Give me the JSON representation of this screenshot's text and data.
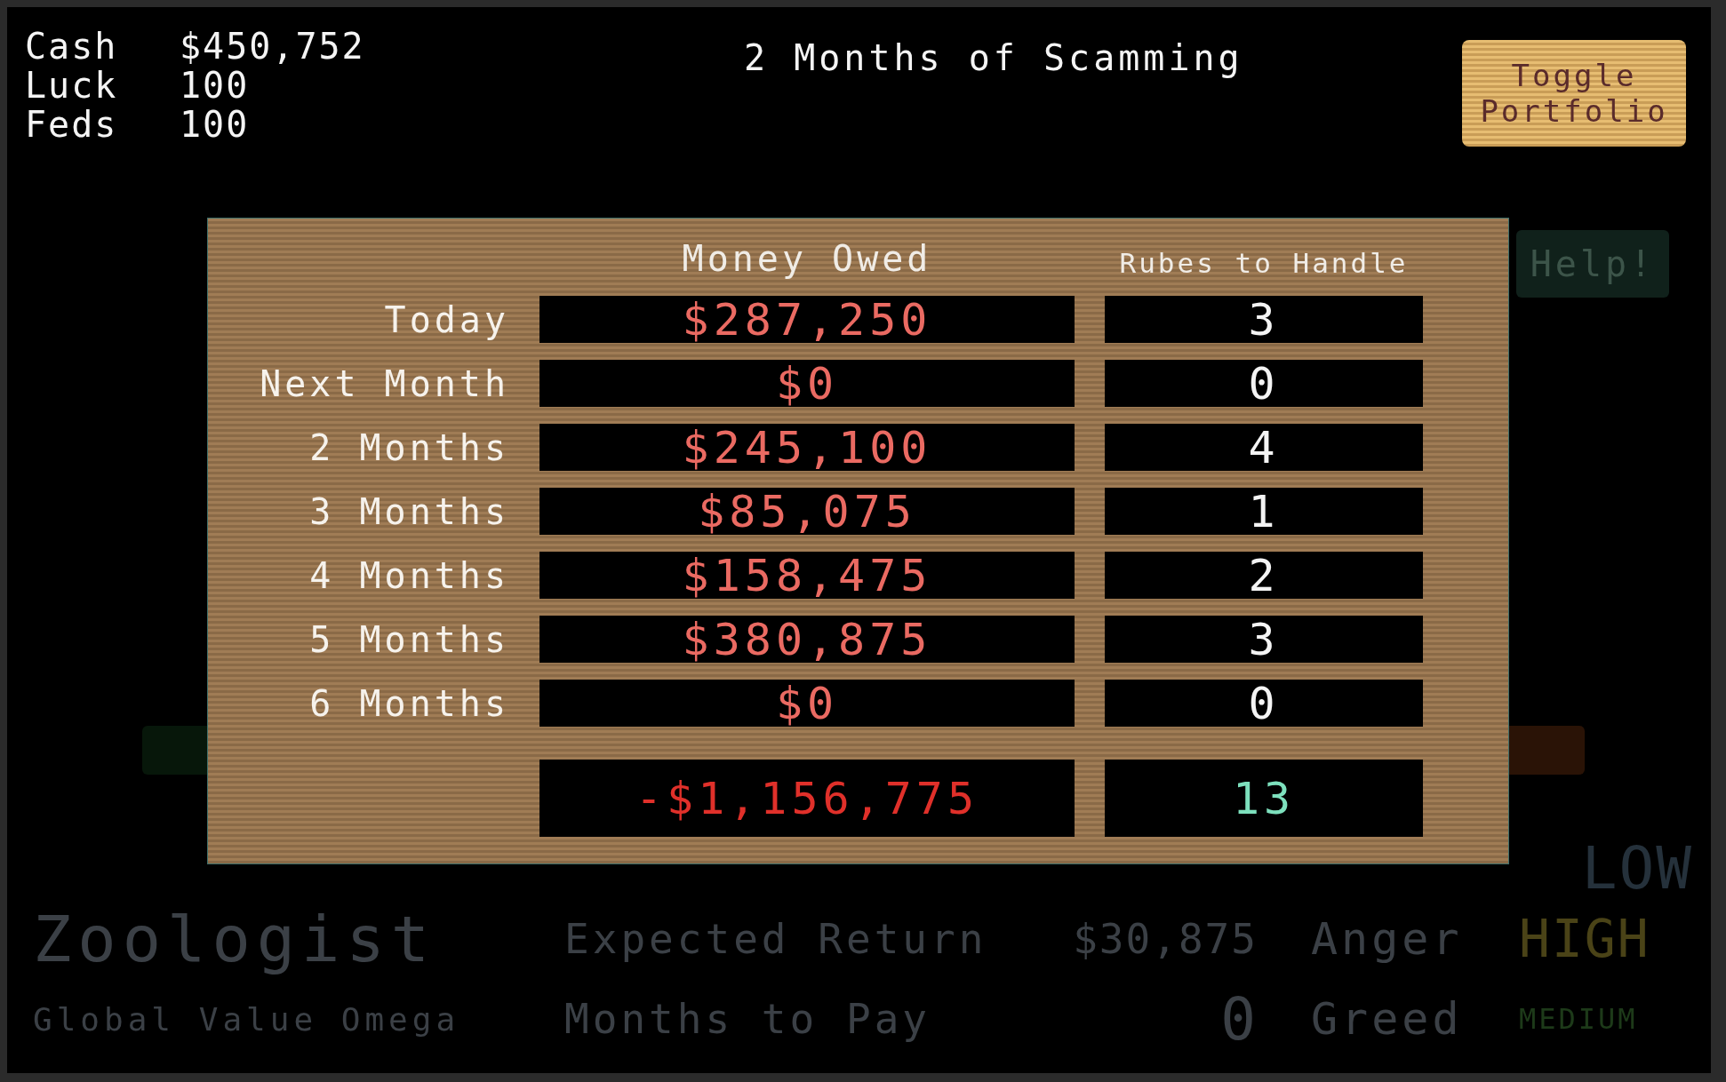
{
  "stats": [
    {
      "label": "Cash",
      "value": "$450,752"
    },
    {
      "label": "Luck",
      "value": "100"
    },
    {
      "label": "Feds",
      "value": "100"
    }
  ],
  "title": "2 Months of Scamming",
  "toggle_button": "Toggle Portfolio",
  "help_button": "Help!",
  "schedule": {
    "columns": [
      "Money Owed",
      "Rubes to Handle"
    ],
    "rows": [
      {
        "label": "Today",
        "owed": "$287,250",
        "rubes": "3"
      },
      {
        "label": "Next Month",
        "owed": "$0",
        "rubes": "0"
      },
      {
        "label": "2 Months",
        "owed": "$245,100",
        "rubes": "4"
      },
      {
        "label": "3 Months",
        "owed": "$85,075",
        "rubes": "1"
      },
      {
        "label": "4 Months",
        "owed": "$158,475",
        "rubes": "2"
      },
      {
        "label": "5 Months",
        "owed": "$380,875",
        "rubes": "3"
      },
      {
        "label": "6 Months",
        "owed": "$0",
        "rubes": "0"
      }
    ],
    "total": {
      "owed": "-$1,156,775",
      "rubes": "13"
    }
  },
  "client": {
    "rating": {
      "text": "LOW",
      "color": "#25313b"
    },
    "name": "Zoologist",
    "company": "Global Value Omega",
    "details": [
      {
        "label": "Expected Return",
        "value": "$30,875"
      },
      {
        "label": "Months to Pay",
        "value": "0"
      }
    ],
    "traits": [
      {
        "label": "Anger",
        "level_text": "HIGH",
        "color": "#4a4317"
      },
      {
        "label": "Greed",
        "level_text": "MEDIUM",
        "color": "#1d3a19"
      }
    ]
  }
}
